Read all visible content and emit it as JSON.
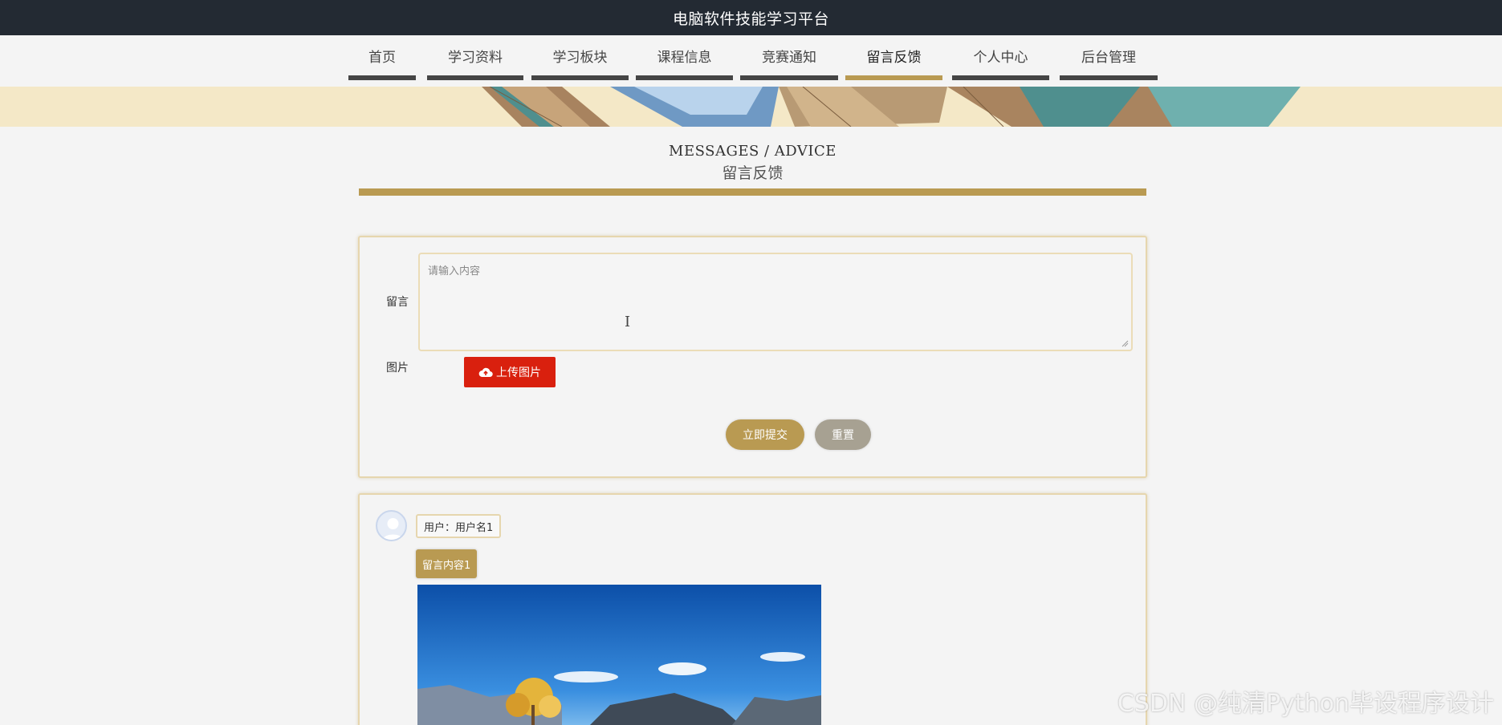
{
  "header": {
    "title": "电脑软件技能学习平台"
  },
  "nav": {
    "items": [
      {
        "label": "首页"
      },
      {
        "label": "学习资料"
      },
      {
        "label": "学习板块"
      },
      {
        "label": "课程信息"
      },
      {
        "label": "竞赛通知"
      },
      {
        "label": "留言反馈",
        "active": true
      },
      {
        "label": "个人中心"
      },
      {
        "label": "后台管理"
      }
    ]
  },
  "section": {
    "title_en": "MESSAGES / ADVICE",
    "title_cn": "留言反馈"
  },
  "form": {
    "message_label": "留言",
    "message_placeholder": "请输入内容",
    "message_value": "",
    "image_label": "图片",
    "upload_button": "上传图片",
    "submit_button": "立即提交",
    "reset_button": "重置"
  },
  "messages": [
    {
      "user": "用户：用户名1",
      "content": "留言内容1"
    }
  ],
  "watermark": "CSDN @纯清Python毕设程序设计",
  "colors": {
    "accent": "#b99a52",
    "upload": "#d9200e",
    "reset": "#a7a192",
    "topbar": "#232a33",
    "banner_bg": "#f4e8c7"
  }
}
